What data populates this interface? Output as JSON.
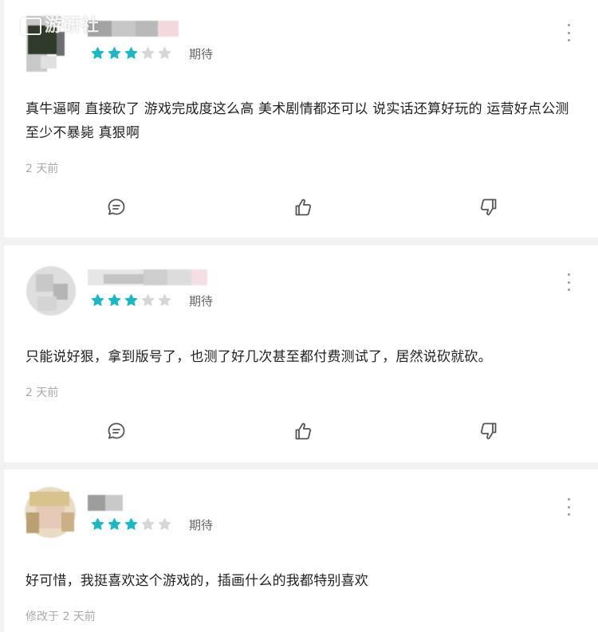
{
  "watermark": {
    "text": "游研社"
  },
  "colors": {
    "star_filled": "#18b9c6",
    "star_empty": "#d7d7d7",
    "icon": "#555555"
  },
  "icons": {
    "comment": "comment-icon",
    "like": "thumbs-up-icon",
    "dislike": "thumbs-down-icon",
    "more": "more-vertical-icon"
  },
  "reviews": [
    {
      "rating": 3,
      "rating_max": 5,
      "rating_label": "期待",
      "content": "真牛逼啊 直接砍了 游戏完成度这么高 美术剧情都还可以 说实话还算好玩的 运营好点公测至少不暴毙 真狠啊",
      "time": "2 天前"
    },
    {
      "rating": 3,
      "rating_max": 5,
      "rating_label": "期待",
      "content": "只能说好狠，拿到版号了，也测了好几次甚至都付费测试了，居然说砍就砍。",
      "time": "2 天前"
    },
    {
      "rating": 3,
      "rating_max": 5,
      "rating_label": "期待",
      "content": "好可惜，我挺喜欢这个游戏的，插画什么的我都特别喜欢",
      "time": "修改于 2 天前"
    }
  ]
}
